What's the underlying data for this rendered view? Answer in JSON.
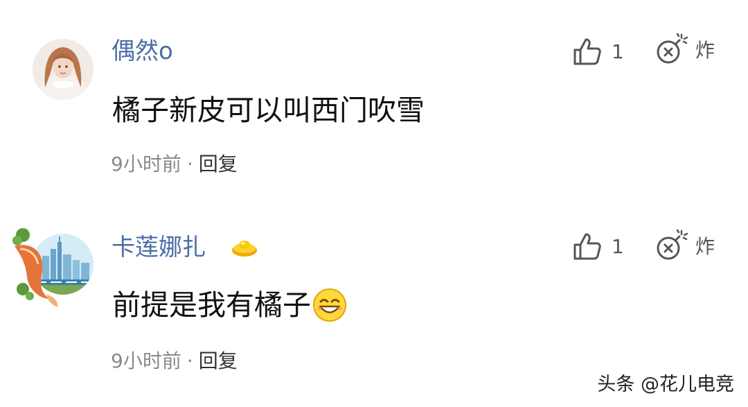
{
  "comments": [
    {
      "username": "偶然o",
      "text": "橘子新皮可以叫西门吹雪",
      "time": "9小时前",
      "separator": "·",
      "reply_label": "回复",
      "like_count": "1",
      "bury_label": "炸",
      "has_badge": false,
      "emoji": null
    },
    {
      "username": "卡莲娜扎",
      "text": "前提是我有橘子",
      "time": "9小时前",
      "separator": "·",
      "reply_label": "回复",
      "like_count": "1",
      "bury_label": "炸",
      "has_badge": true,
      "emoji": "grinning-face-emoji"
    }
  ],
  "watermark": "头条 @花儿电竞",
  "colors": {
    "username": "#4a6ea3",
    "text": "#111111",
    "meta": "#8a8a8a",
    "icon": "#555555",
    "badge": "#f5c518"
  },
  "icons": {
    "like": "thumbs-up-icon",
    "bury": "bomb-icon",
    "badge": "gold-ingot-icon"
  }
}
